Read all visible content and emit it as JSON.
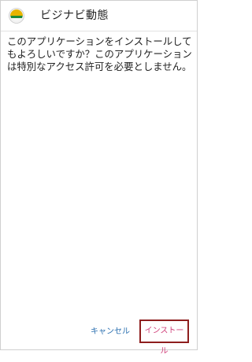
{
  "header": {
    "app_name": "ビジナビ動態",
    "app_icon": "android-app-icon"
  },
  "dialog": {
    "message": "このアプリケーションをインストールしてもよろしいですか？このアプリケーションは特別なアクセス許可を必要としません。"
  },
  "buttons": {
    "cancel_label": "キャンセル",
    "install_label": "インストール"
  },
  "colors": {
    "button_text": "#2a6fb0",
    "install_text": "#d0427b",
    "highlight_border": "#8e1e1e"
  }
}
